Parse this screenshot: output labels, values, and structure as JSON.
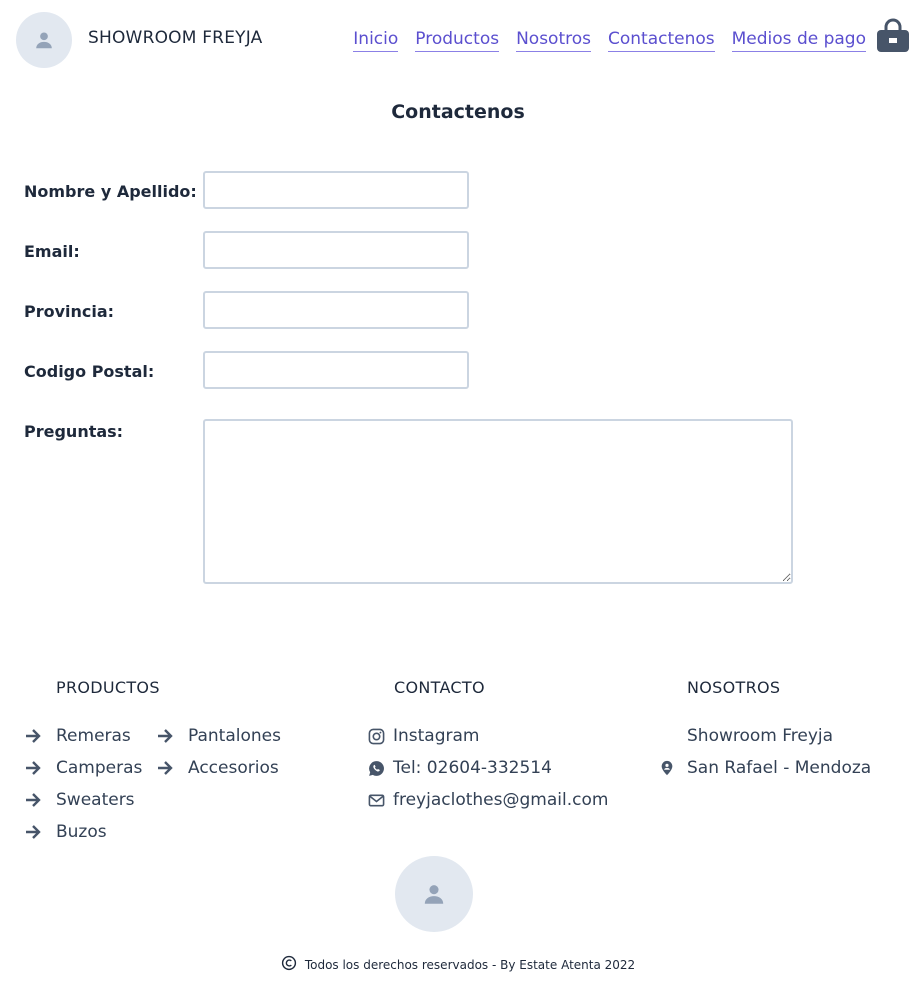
{
  "header": {
    "brand": "SHOWROOM FREYJA",
    "nav": [
      {
        "label": "Inicio"
      },
      {
        "label": "Productos"
      },
      {
        "label": "Nosotros"
      },
      {
        "label": "Contactenos"
      },
      {
        "label": "Medios de pago"
      }
    ],
    "cart_icon": "shopping-bag-icon",
    "logo_icon": "user-avatar-icon"
  },
  "form": {
    "title": "Contactenos",
    "fields": [
      {
        "label": "Nombre y Apellido:",
        "value": "",
        "placeholder": ""
      },
      {
        "label": "Email:",
        "value": "",
        "placeholder": ""
      },
      {
        "label": "Provincia:",
        "value": "",
        "placeholder": ""
      },
      {
        "label": "Codigo Postal:",
        "value": "",
        "placeholder": ""
      }
    ],
    "questions": {
      "label": "Preguntas:",
      "value": ""
    }
  },
  "footer": {
    "productos": {
      "heading": "PRODUCTOS",
      "col1": [
        "Remeras",
        "Camperas",
        "Sweaters",
        "Buzos"
      ],
      "col2": [
        "Pantalones",
        "Accesorios"
      ]
    },
    "contacto": {
      "heading": "CONTACTO",
      "items": [
        {
          "icon": "instagram-icon",
          "text": "Instagram"
        },
        {
          "icon": "whatsapp-icon",
          "text": "Tel: 02604-332514"
        },
        {
          "icon": "mail-icon",
          "text": "freyjaclothes@gmail.com"
        }
      ]
    },
    "nosotros": {
      "heading": "NOSOTROS",
      "name": "Showroom Freyja",
      "location": "San Rafael - Mendoza"
    },
    "copyright": "Todos los derechos reservados - By Estate Atenta 2022"
  },
  "colors": {
    "link": "#5b4fcf",
    "text": "#334155",
    "avatar_bg": "#e2e8f0",
    "icon": "#475569",
    "input_border": "#cbd5e1"
  }
}
